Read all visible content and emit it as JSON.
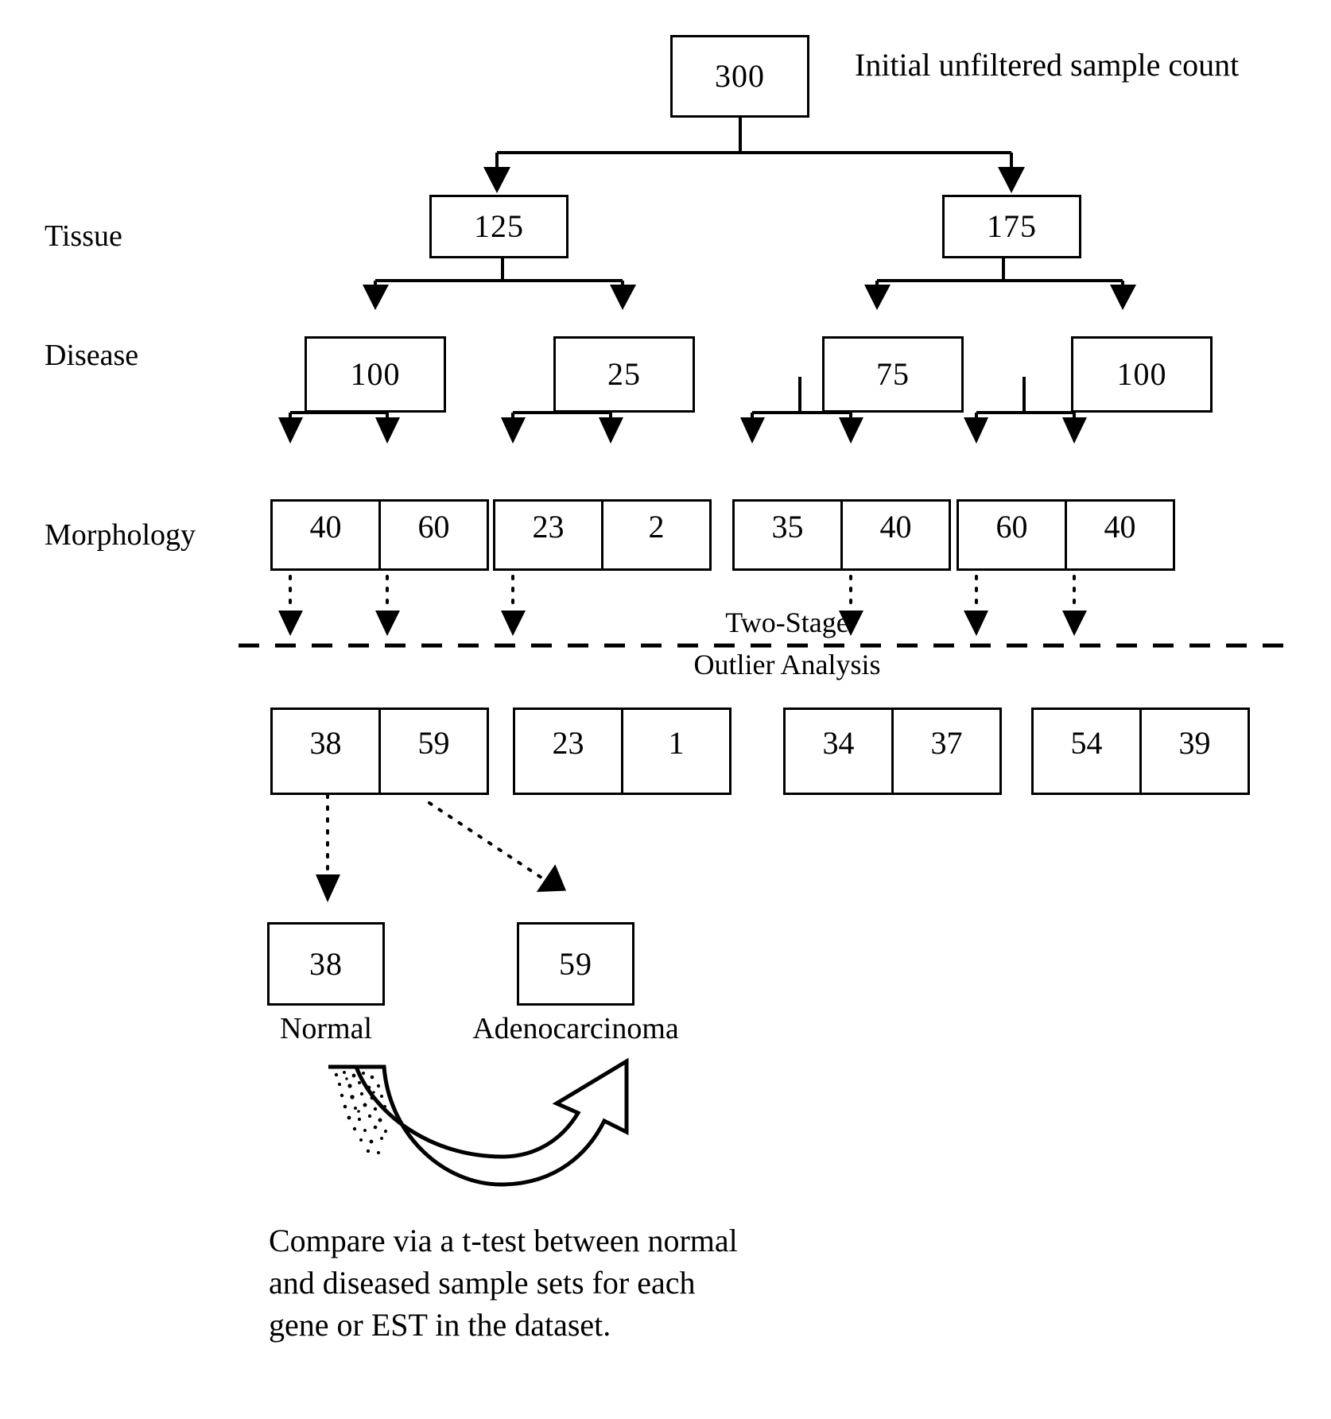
{
  "diagram": {
    "title_note": "Initial unfiltered sample count",
    "row_labels": {
      "tissue": "Tissue",
      "disease": "Disease",
      "morphology": "Morphology"
    },
    "stage_divider": {
      "line1": "Two-Stage",
      "line2": "Outlier Analysis"
    },
    "root": {
      "value": "300"
    },
    "tissue_nodes": [
      {
        "value": "125"
      },
      {
        "value": "175"
      }
    ],
    "disease_nodes": [
      {
        "value": "100"
      },
      {
        "value": "25"
      },
      {
        "value": "75"
      },
      {
        "value": "100"
      }
    ],
    "morphology_pairs": [
      {
        "left": "40",
        "right": "60"
      },
      {
        "left": "23",
        "right": "2"
      },
      {
        "left": "35",
        "right": "40"
      },
      {
        "left": "60",
        "right": "40"
      }
    ],
    "filtered_pairs": [
      {
        "left": "38",
        "right": "59"
      },
      {
        "left": "23",
        "right": "1"
      },
      {
        "left": "34",
        "right": "37"
      },
      {
        "left": "54",
        "right": "39"
      }
    ],
    "final_nodes": [
      {
        "value": "38",
        "label": "Normal"
      },
      {
        "value": "59",
        "label": "Adenocarcinoma"
      }
    ],
    "caption": {
      "line1": "Compare via a t-test between normal",
      "line2": "and diseased sample sets for each",
      "line3": "gene or EST in the dataset."
    },
    "colors": {
      "stroke": "#000000",
      "background": "#ffffff"
    }
  }
}
